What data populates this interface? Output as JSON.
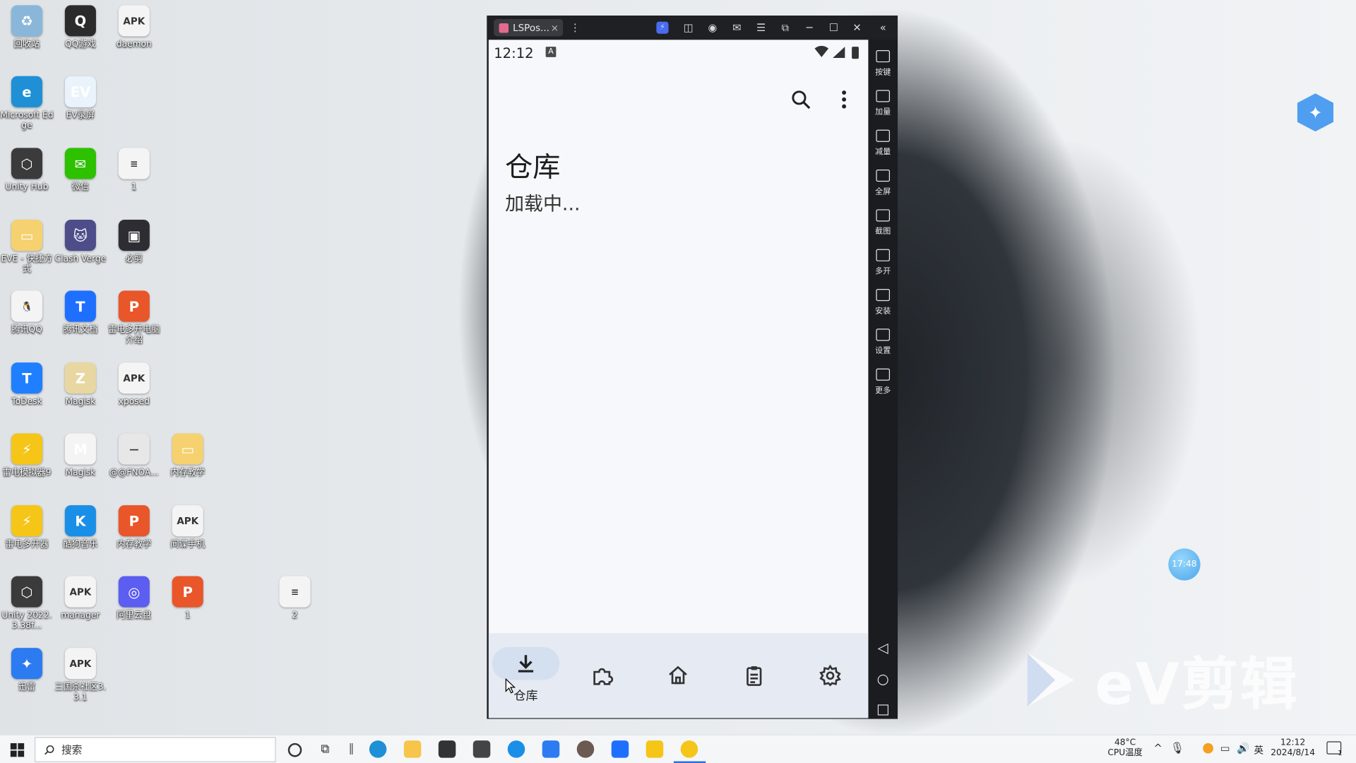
{
  "desktop": {
    "icons": [
      {
        "label": "回收站",
        "color": "#8ab7d9",
        "glyph": "♻"
      },
      {
        "label": "QQ游戏",
        "color": "#2b2b2b",
        "glyph": "Q"
      },
      {
        "label": "daemon",
        "color": "#f4f4f4",
        "glyph": "APK"
      },
      {
        "label": "Microsoft Edge",
        "color": "#1f8fd6",
        "glyph": "e"
      },
      {
        "label": "EV录屏",
        "color": "#eaf3fb",
        "glyph": "EV"
      },
      {
        "label": "Unity Hub",
        "color": "#3b3b3b",
        "glyph": "⬡"
      },
      {
        "label": "微信",
        "color": "#2dc100",
        "glyph": "✉"
      },
      {
        "label": "1",
        "color": "#f4f4f4",
        "glyph": "≡"
      },
      {
        "label": "EVE - 快捷方式",
        "color": "#f6d16f",
        "glyph": "▭"
      },
      {
        "label": "Clash Verge",
        "color": "#4d4d8a",
        "glyph": "🐱"
      },
      {
        "label": "必剪",
        "color": "#2d2d33",
        "glyph": "▣"
      },
      {
        "label": "腾讯QQ",
        "color": "#f4f4f4",
        "glyph": "🐧"
      },
      {
        "label": "腾讯文档",
        "color": "#1f6fff",
        "glyph": "T"
      },
      {
        "label": "雷电多开电脑介绍",
        "color": "#e8562a",
        "glyph": "P"
      },
      {
        "label": "ToDesk",
        "color": "#1f7fff",
        "glyph": "T"
      },
      {
        "label": "Magisk",
        "color": "#e9d7a1",
        "glyph": "Z"
      },
      {
        "label": "xposed",
        "color": "#f4f4f4",
        "glyph": "APK"
      },
      {
        "label": "雷电模拟器9",
        "color": "#f5c518",
        "glyph": "⚡"
      },
      {
        "label": "Magisk",
        "color": "#f4f4f4",
        "glyph": "M"
      },
      {
        "label": "@@FNOA...",
        "color": "#e7e7e7",
        "glyph": "—"
      },
      {
        "label": "内存教学",
        "color": "#f6d16f",
        "glyph": "▭"
      },
      {
        "label": "雷电多开器",
        "color": "#f5c518",
        "glyph": "⚡"
      },
      {
        "label": "酷狗音乐",
        "color": "#1a8fe8",
        "glyph": "K"
      },
      {
        "label": "内存教学",
        "color": "#e8562a",
        "glyph": "P"
      },
      {
        "label": "间谍手机",
        "color": "#f4f4f4",
        "glyph": "APK"
      },
      {
        "label": "Unity 2022.3.38f...",
        "color": "#3b3b3b",
        "glyph": "⬡"
      },
      {
        "label": "manager",
        "color": "#f4f4f4",
        "glyph": "APK"
      },
      {
        "label": "阿里云盘",
        "color": "#5b5ef0",
        "glyph": "◎"
      },
      {
        "label": "1",
        "color": "#e8562a",
        "glyph": "P"
      },
      {
        "label": "2",
        "color": "#f4f4f4",
        "glyph": "≡"
      },
      {
        "label": "迅雷",
        "color": "#2d7bf0",
        "glyph": "✦"
      },
      {
        "label": "三国杀社区3.3.1",
        "color": "#f4f4f4",
        "glyph": "APK"
      }
    ]
  },
  "emulator": {
    "tab_label": "LSPos...",
    "tab_close": "×",
    "sidebar": [
      {
        "label": "按键"
      },
      {
        "label": "加量"
      },
      {
        "label": "减量"
      },
      {
        "label": "全屏"
      },
      {
        "label": "截图"
      },
      {
        "label": "多开"
      },
      {
        "label": "安装"
      },
      {
        "label": "设置"
      },
      {
        "label": "更多"
      }
    ]
  },
  "phone": {
    "status_time": "12:12",
    "status_badge": "A",
    "page_title": "仓库",
    "loading_text": "加载中...",
    "nav": [
      {
        "label": "仓库",
        "icon": "download-icon",
        "active": true
      },
      {
        "label": "",
        "icon": "puzzle-icon",
        "active": false
      },
      {
        "label": "",
        "icon": "home-icon",
        "active": false
      },
      {
        "label": "",
        "icon": "clipboard-icon",
        "active": false
      },
      {
        "label": "",
        "icon": "settings-icon",
        "active": false
      }
    ]
  },
  "overlay": {
    "bubble_time": "17:48",
    "watermark": "eV剪辑"
  },
  "taskbar": {
    "search_placeholder": "搜索",
    "temp": "48°C",
    "temp_label": "CPU温度",
    "ime": "英",
    "clock_time": "12:12",
    "clock_date": "2024/8/14",
    "notif_count": "1"
  }
}
